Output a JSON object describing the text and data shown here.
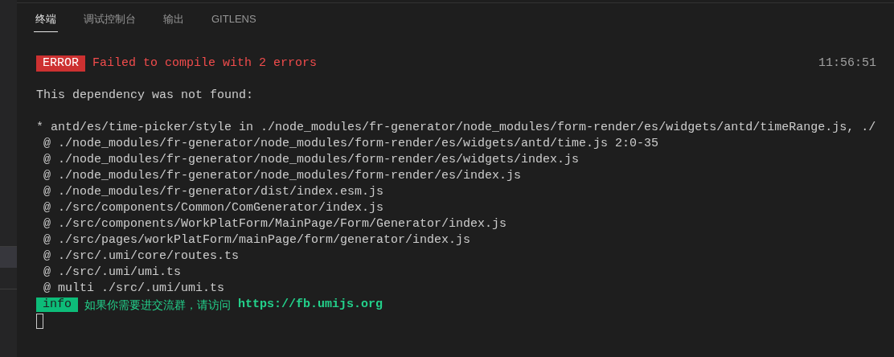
{
  "tabs": [
    {
      "label": "终端",
      "selected": true
    },
    {
      "label": "调试控制台",
      "selected": false
    },
    {
      "label": "输出",
      "selected": false
    },
    {
      "label": "GITLENS",
      "selected": false
    }
  ],
  "terminal": {
    "error": {
      "badge": "ERROR",
      "message": "Failed to compile with 2 errors",
      "time": "11:56:51"
    },
    "lines": [
      {
        "kind": "text",
        "text": "This dependency was not found:"
      },
      {
        "kind": "blank"
      },
      {
        "kind": "text",
        "text": "* antd/es/time-picker/style in ./node_modules/fr-generator/node_modules/form-render/es/widgets/antd/timeRange.js, ./"
      },
      {
        "kind": "text",
        "text": " @ ./node_modules/fr-generator/node_modules/form-render/es/widgets/antd/time.js 2:0-35"
      },
      {
        "kind": "text",
        "text": " @ ./node_modules/fr-generator/node_modules/form-render/es/widgets/index.js"
      },
      {
        "kind": "text",
        "text": " @ ./node_modules/fr-generator/node_modules/form-render/es/index.js"
      },
      {
        "kind": "text",
        "text": " @ ./node_modules/fr-generator/dist/index.esm.js"
      },
      {
        "kind": "text",
        "text": " @ ./src/components/Common/ComGenerator/index.js"
      },
      {
        "kind": "text",
        "text": " @ ./src/components/WorkPlatForm/MainPage/Form/Generator/index.js"
      },
      {
        "kind": "text",
        "text": " @ ./src/pages/workPlatForm/mainPage/form/generator/index.js"
      },
      {
        "kind": "text",
        "text": " @ ./src/.umi/core/routes.ts"
      },
      {
        "kind": "text",
        "text": " @ ./src/.umi/umi.ts"
      },
      {
        "kind": "text",
        "text": " @ multi ./src/.umi/umi.ts"
      }
    ],
    "info": {
      "badge": "info",
      "message": "如果你需要进交流群，请访问",
      "link": "https://fb.umijs.org"
    }
  }
}
